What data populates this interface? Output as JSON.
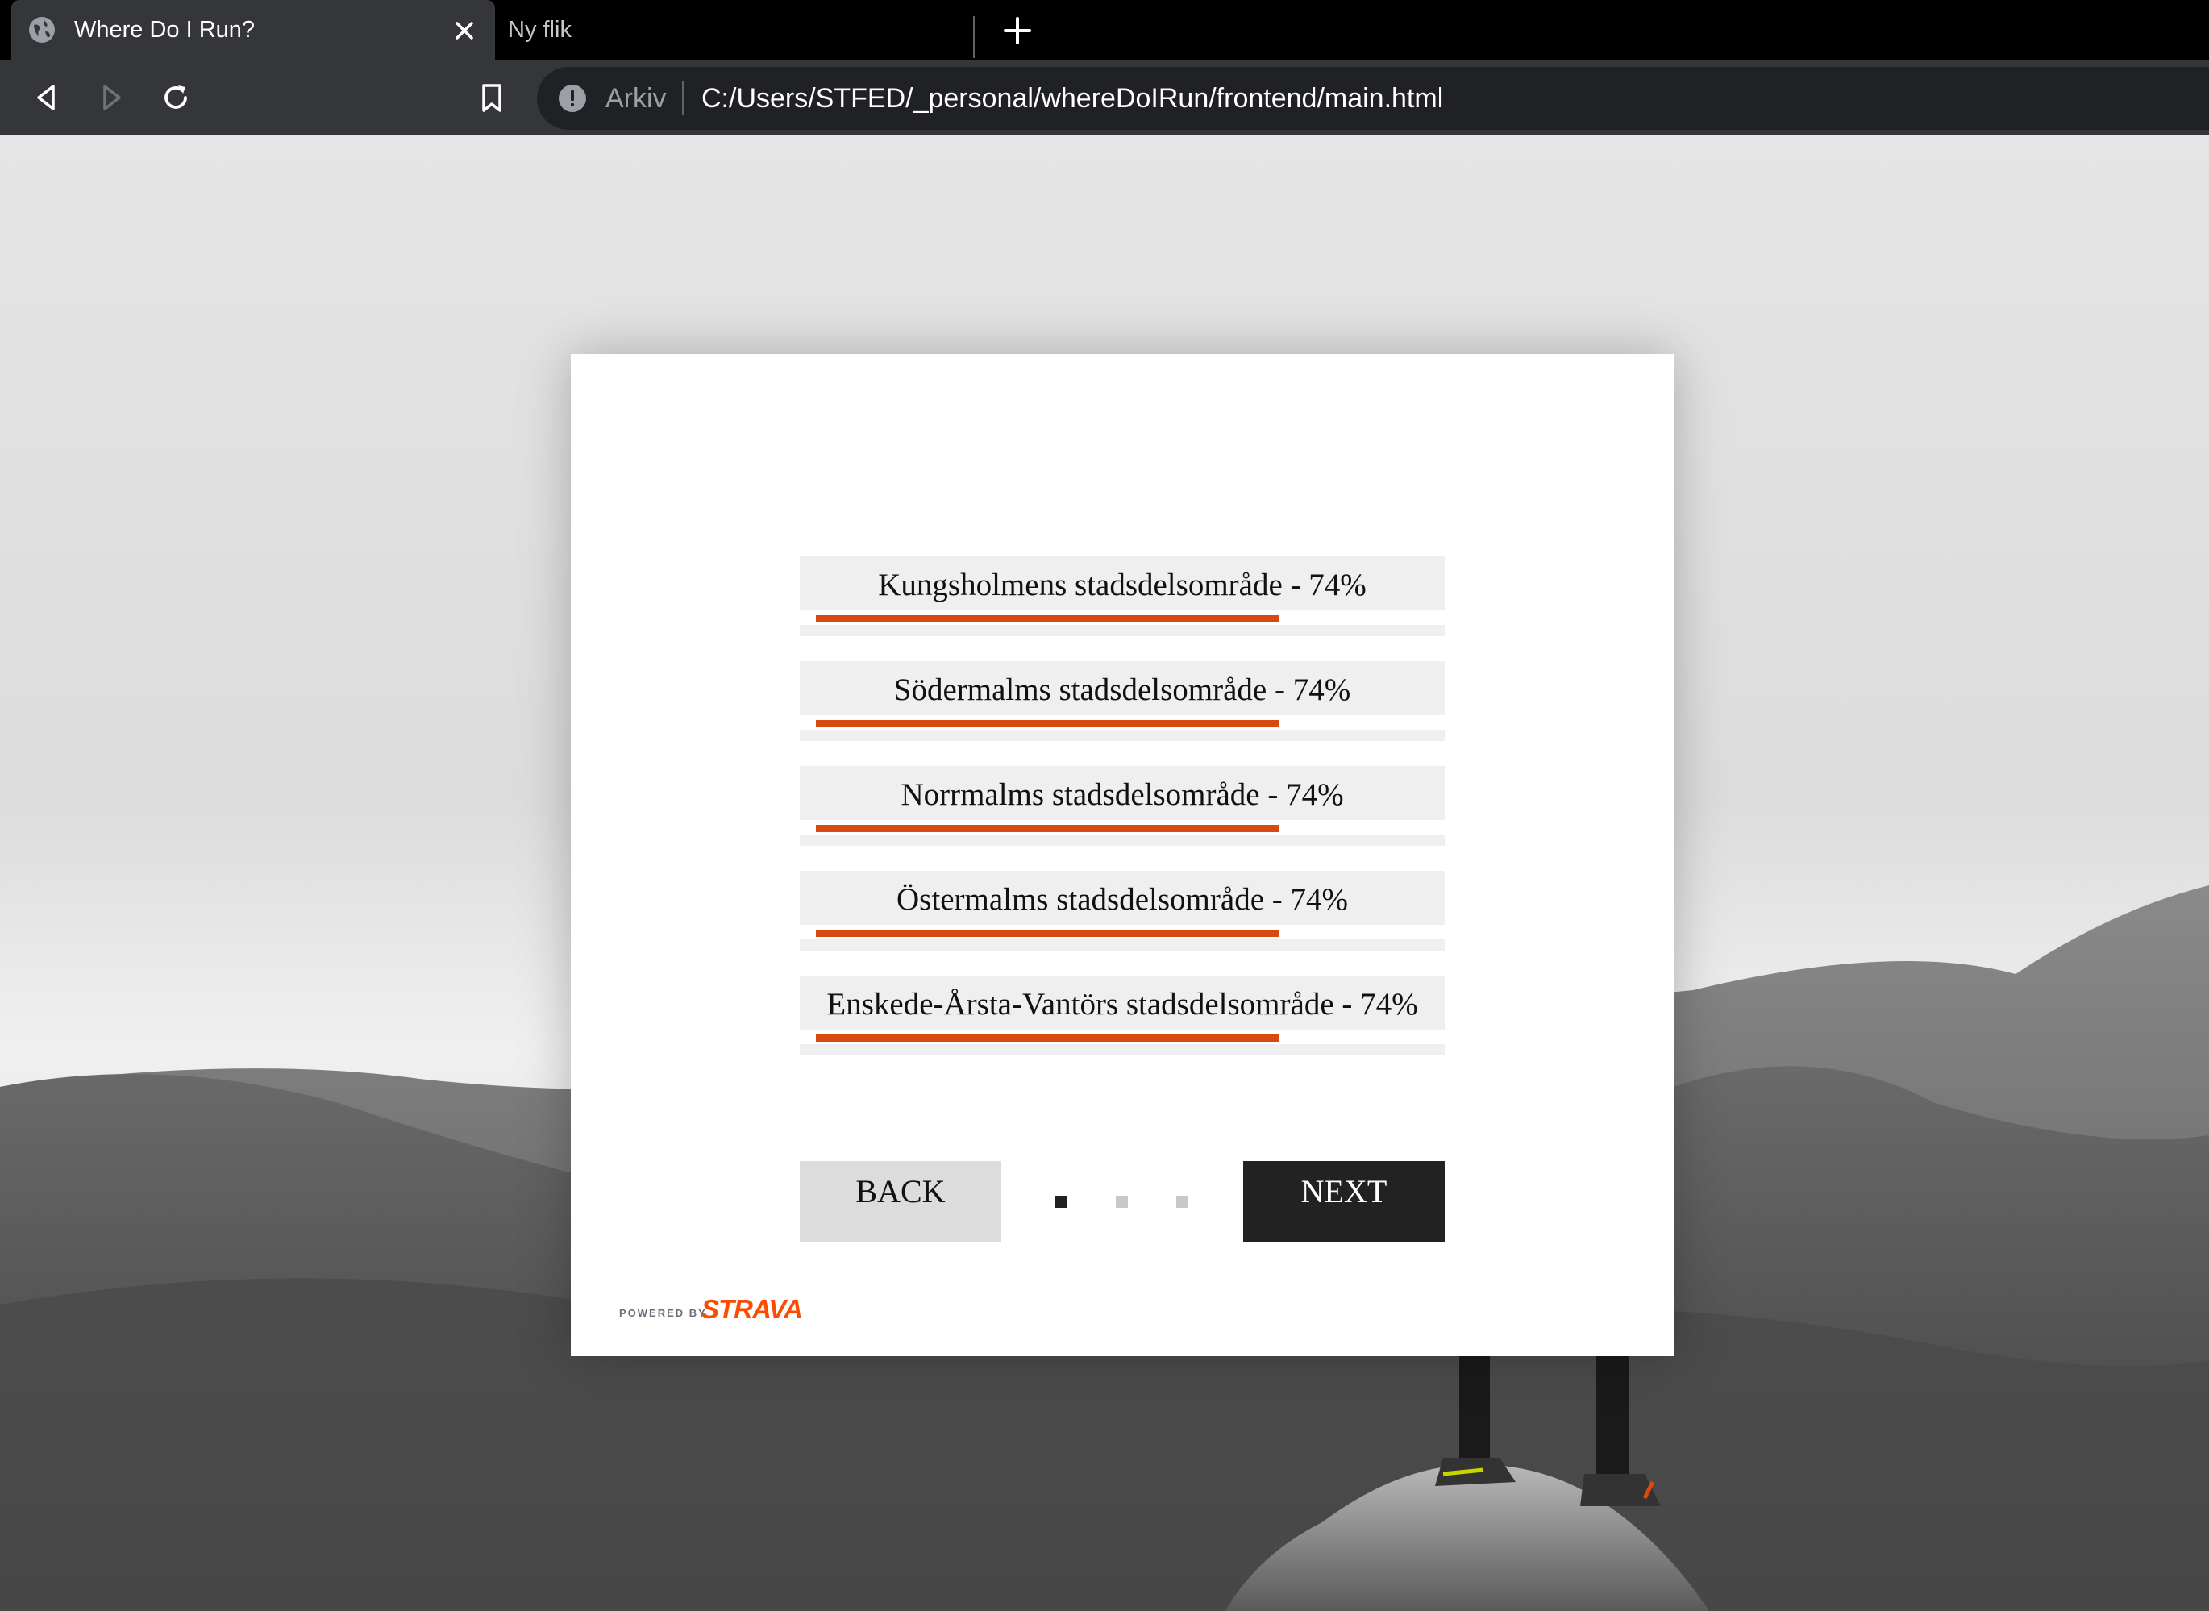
{
  "browser": {
    "tabs": [
      {
        "title": "Where Do I Run?",
        "active": true
      },
      {
        "title": "Ny flik",
        "active": false
      }
    ],
    "omnibox": {
      "security_label": "Arkiv",
      "url": "C:/Users/STFED/_personal/whereDoIRun/frontend/main.html"
    }
  },
  "results": [
    {
      "label": "Kungsholmens stadsdelsområde - 74%",
      "percent": 74
    },
    {
      "label": "Södermalms stadsdelsområde - 74%",
      "percent": 74
    },
    {
      "label": "Norrmalms stadsdelsområde - 74%",
      "percent": 74
    },
    {
      "label": "Östermalms stadsdelsområde - 74%",
      "percent": 74
    },
    {
      "label": "Enskede-Årsta-Vantörs stadsdelsområde - 74%",
      "percent": 74
    }
  ],
  "navigation": {
    "back_label": "BACK",
    "next_label": "NEXT",
    "pages": 3,
    "current_page": 1
  },
  "branding": {
    "powered_by": "POWERED BY",
    "strava": "STRAVA",
    "accent_color": "#fc4c02",
    "progress_color": "#d84a12"
  }
}
